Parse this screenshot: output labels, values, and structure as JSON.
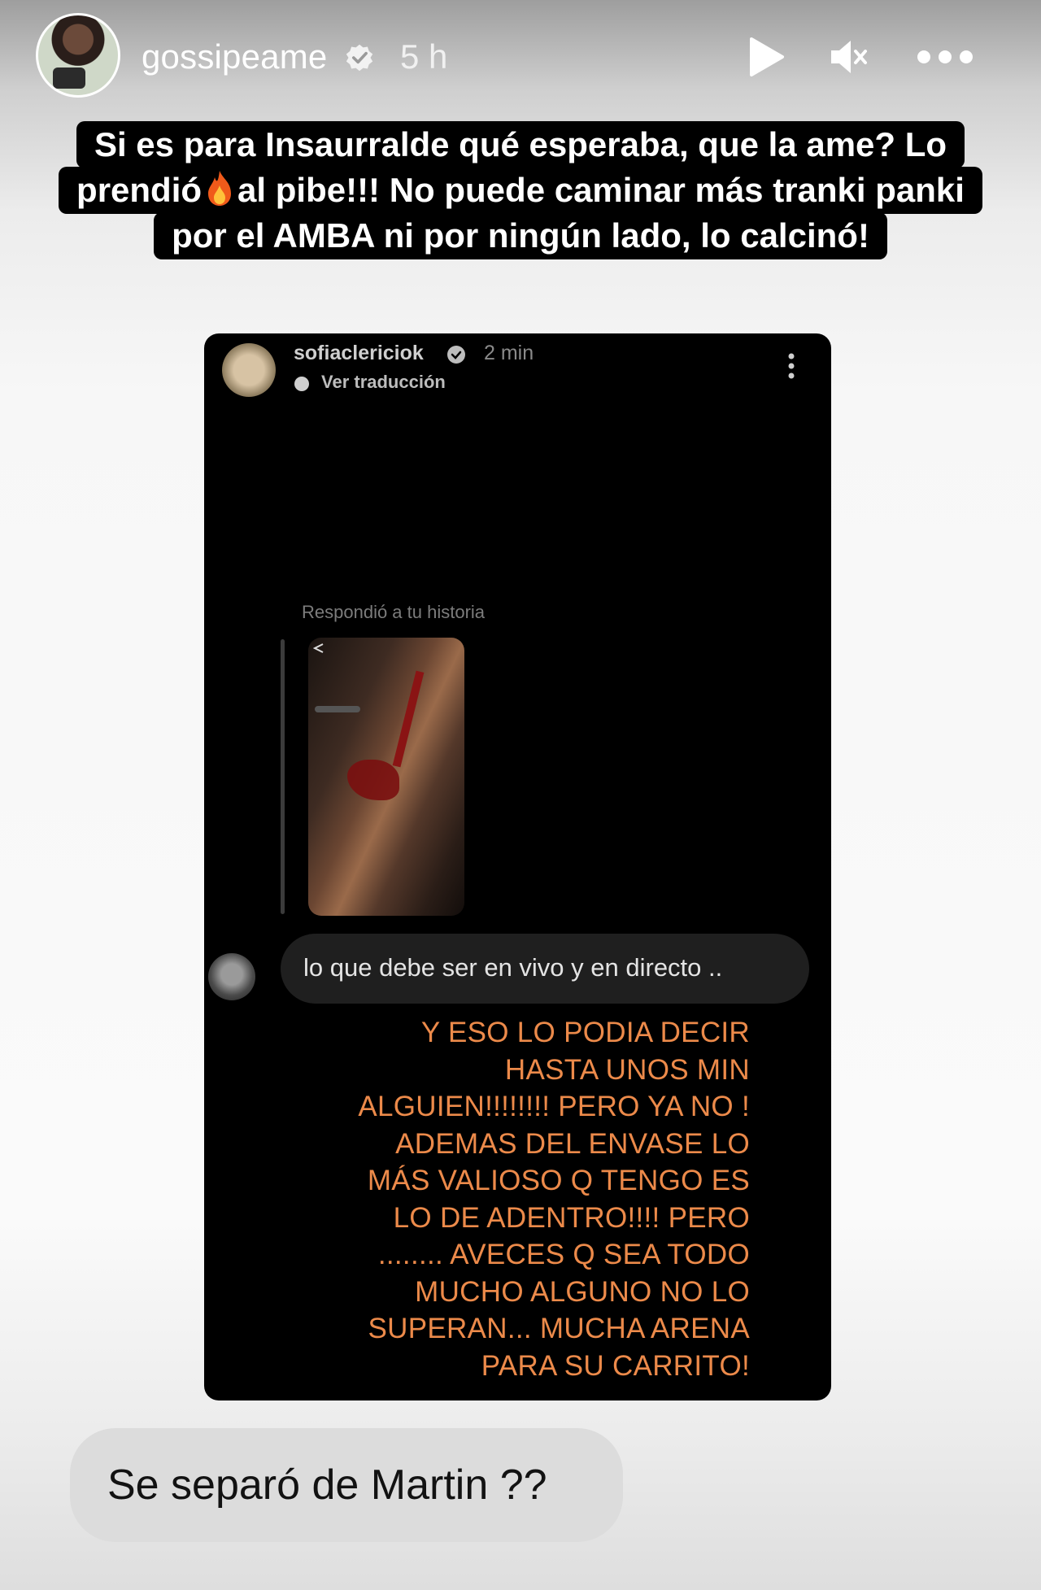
{
  "header": {
    "username": "gossipeame",
    "time": "5 h",
    "verified_icon": "verified-badge-icon",
    "controls": [
      "play-icon",
      "mute-icon",
      "more-icon"
    ]
  },
  "caption": {
    "lines": [
      "Si es para Insaurralde qué esperaba, que la ame? Lo",
      [
        "prendió",
        "al pibe!!! No puede caminar más tranki panki"
      ],
      "por el AMBA ni por ningún lado, lo calcinó!"
    ],
    "emoji": "fire-icon"
  },
  "shared_post": {
    "username": "sofiaclericiok",
    "time": "2 min",
    "translation_link": "Ver traducción",
    "replied_label": "Respondió a tu historia",
    "message": "lo que debe ser en vivo y en directo ..",
    "reply_text": [
      "Y ESO LO PODIA DECIR",
      "HASTA UNOS MIN",
      "ALGUIEN!!!!!!!! PERO YA NO !",
      "ADEMAS DEL ENVASE LO",
      "MÁS VALIOSO Q TENGO ES",
      "LO DE ADENTRO!!!! PERO",
      "........ AVECES Q SEA TODO",
      "MUCHO ALGUNO NO LO",
      "SUPERAN... MUCHA ARENA",
      "PARA SU CARRITO!"
    ],
    "reply_color": "#ec8a4a"
  },
  "question": {
    "text": "Se separó de Martin ??"
  }
}
